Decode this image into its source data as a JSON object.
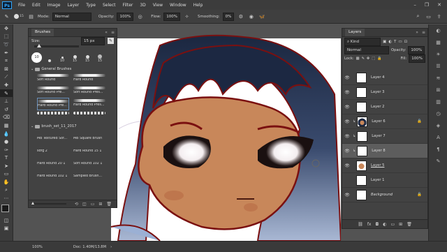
{
  "menu": {
    "logo": "Ps",
    "items": [
      "File",
      "Edit",
      "Image",
      "Layer",
      "Type",
      "Select",
      "Filter",
      "3D",
      "View",
      "Window",
      "Help"
    ]
  },
  "options": {
    "size_value": "15",
    "mode_label": "Mode:",
    "mode_value": "Normal",
    "opacity_label": "Opacity:",
    "opacity_value": "100%",
    "flow_label": "Flow:",
    "flow_value": "100%",
    "smoothing_label": "Smoothing:",
    "smoothing_value": "0%"
  },
  "brushes": {
    "tab": "Brushes",
    "size_label": "Size:",
    "size_value": "15 px",
    "presets": [
      "10",
      "15",
      "15",
      "15"
    ],
    "group1": "General Brushes",
    "group1_items": [
      "Soft Round",
      "Hard Round",
      "Soft Round Pre...",
      "Soft Round Pres...",
      "Hard Round Pre...",
      "Hard Round Pres...",
      "",
      ""
    ],
    "group2": "brush_set_11_2017",
    "group2_items": [
      "MB Textured Sof...",
      "MB Square Brush",
      "sdfg 2",
      "Hard Round 15 1",
      "Hard Round 20 1",
      "Soft Round 102 1",
      "Hard Round 102 1",
      "Sampled Brush..."
    ]
  },
  "layers": {
    "tab": "Layers",
    "kind_label": "Kind",
    "blend_mode": "Normal",
    "opacity_label": "Opacity:",
    "opacity_value": "100%",
    "lock_label": "Lock:",
    "fill_label": "Fill:",
    "fill_value": "100%",
    "rows": [
      "Layer 4",
      "Layer 3",
      "Layer 2",
      "Layer 6",
      "Layer 7",
      "Layer 8",
      "Layer 5",
      "Layer 1",
      "Background"
    ],
    "selected": "Layer 8"
  },
  "status": {
    "zoom": "100%",
    "doc": "Doc: 1.40M/13.8M"
  },
  "colors": {
    "accent": "#31a8ff",
    "panel": "#424242",
    "selected_row": "#5d5d5d"
  }
}
